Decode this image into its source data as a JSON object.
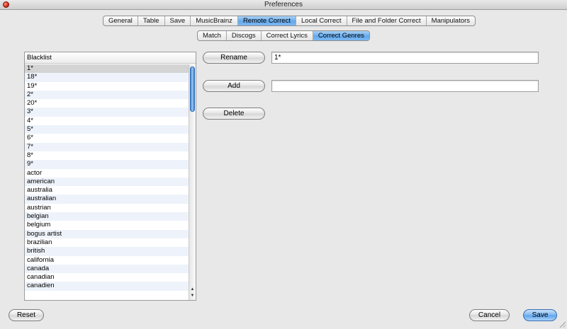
{
  "window": {
    "title": "Preferences"
  },
  "tabs": {
    "main": [
      {
        "label": "General",
        "active": false
      },
      {
        "label": "Table",
        "active": false
      },
      {
        "label": "Save",
        "active": false
      },
      {
        "label": "MusicBrainz",
        "active": false
      },
      {
        "label": "Remote Correct",
        "active": true
      },
      {
        "label": "Local Correct",
        "active": false
      },
      {
        "label": "File and Folder Correct",
        "active": false
      },
      {
        "label": "Manipulators",
        "active": false
      }
    ],
    "sub": [
      {
        "label": "Match",
        "active": false
      },
      {
        "label": "Discogs",
        "active": false
      },
      {
        "label": "Correct Lyrics",
        "active": false
      },
      {
        "label": "Correct Genres",
        "active": true
      }
    ]
  },
  "blacklist": {
    "header": "Blacklist",
    "selected_index": 0,
    "items": [
      "1*",
      "18*",
      "19*",
      "2*",
      "20*",
      "3*",
      "4*",
      "5*",
      "6*",
      "7*",
      "8*",
      "9*",
      "actor",
      "american",
      "australia",
      "australian",
      "austrian",
      "belgian",
      "belgium",
      "bogus artist",
      "brazilian",
      "british",
      "california",
      "canada",
      "canadian",
      "canadien"
    ]
  },
  "actions": {
    "rename_label": "Rename",
    "rename_value": "1*",
    "add_label": "Add",
    "add_value": "",
    "delete_label": "Delete"
  },
  "footer": {
    "reset_label": "Reset",
    "cancel_label": "Cancel",
    "save_label": "Save"
  },
  "icons": {
    "close": "close-icon",
    "scroll_up": "arrow-up-icon",
    "scroll_down": "arrow-down-icon",
    "resize": "resize-grip-icon"
  },
  "colors": {
    "accent": "#64a8ec",
    "window_bg": "#e8e8e8",
    "row_alt": "#eef3fb",
    "row_selected": "#d4d4d4"
  }
}
